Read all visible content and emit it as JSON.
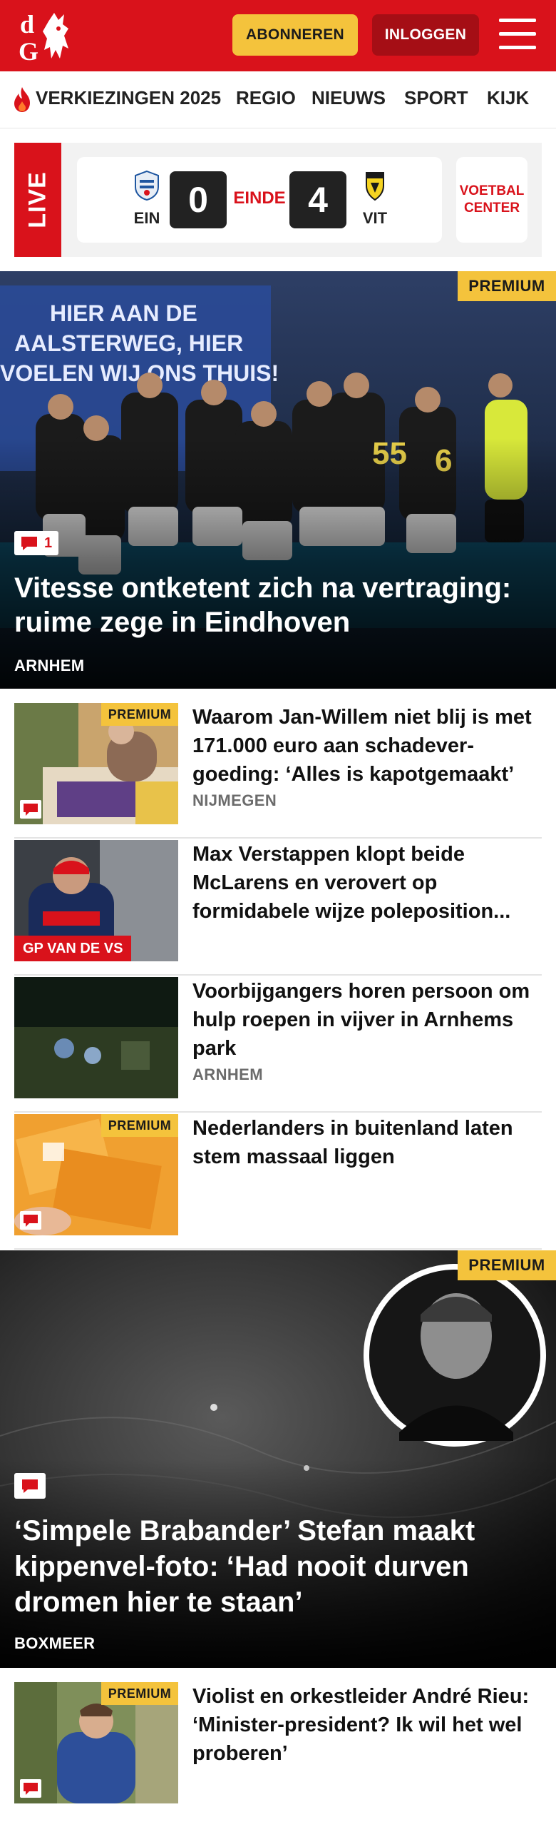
{
  "header": {
    "subscribe_label": "ABONNEREN",
    "login_label": "INLOGGEN",
    "brand_color": "#d9121b",
    "accent_color": "#f4c33c"
  },
  "nav": {
    "items": [
      "VERKIEZINGEN 2025",
      "REGIO",
      "NIEUWS",
      "SPORT",
      "KIJK"
    ]
  },
  "live": {
    "tag": "LIVE",
    "home_team": "EIN",
    "home_score": "0",
    "status": "EINDE",
    "away_score": "4",
    "away_team": "VIT",
    "voetbal_center": "VOETBAL CENTER"
  },
  "hero": {
    "premium": "PREMIUM",
    "comment_count": "1",
    "title": "Vitesse ontketent zich na vertraging: ruime zege in Eindhoven",
    "location": "ARNHEM"
  },
  "articles": [
    {
      "premium": "PREMIUM",
      "title": "Waarom Jan-Willem niet blij is met 171.000 euro aan schadever­goeding: ‘Alles is kapotgemaakt’",
      "location": "NIJMEGEN"
    },
    {
      "category": "GP VAN DE VS",
      "title": "Max Verstappen klopt beide McLarens en verovert op formidabele wijze poleposition..."
    },
    {
      "title": "Voorbijgangers horen persoon om hulp roepen in vijver in Arnhems park",
      "location": "ARNHEM"
    },
    {
      "premium": "PREMIUM",
      "title": "Nederlanders in buitenland laten stem massaal liggen"
    }
  ],
  "feature": {
    "premium": "PREMIUM",
    "title": "‘Simpele Brabander’ Stefan maakt kippenvel-foto: ‘Had nooit durven dromen hier te staan’",
    "location": "BOXMEER"
  },
  "article_bottom": {
    "premium": "PREMIUM",
    "title": "Violist en orkestleider André Rieu: ‘Minister-president? Ik wil het wel proberen’"
  }
}
